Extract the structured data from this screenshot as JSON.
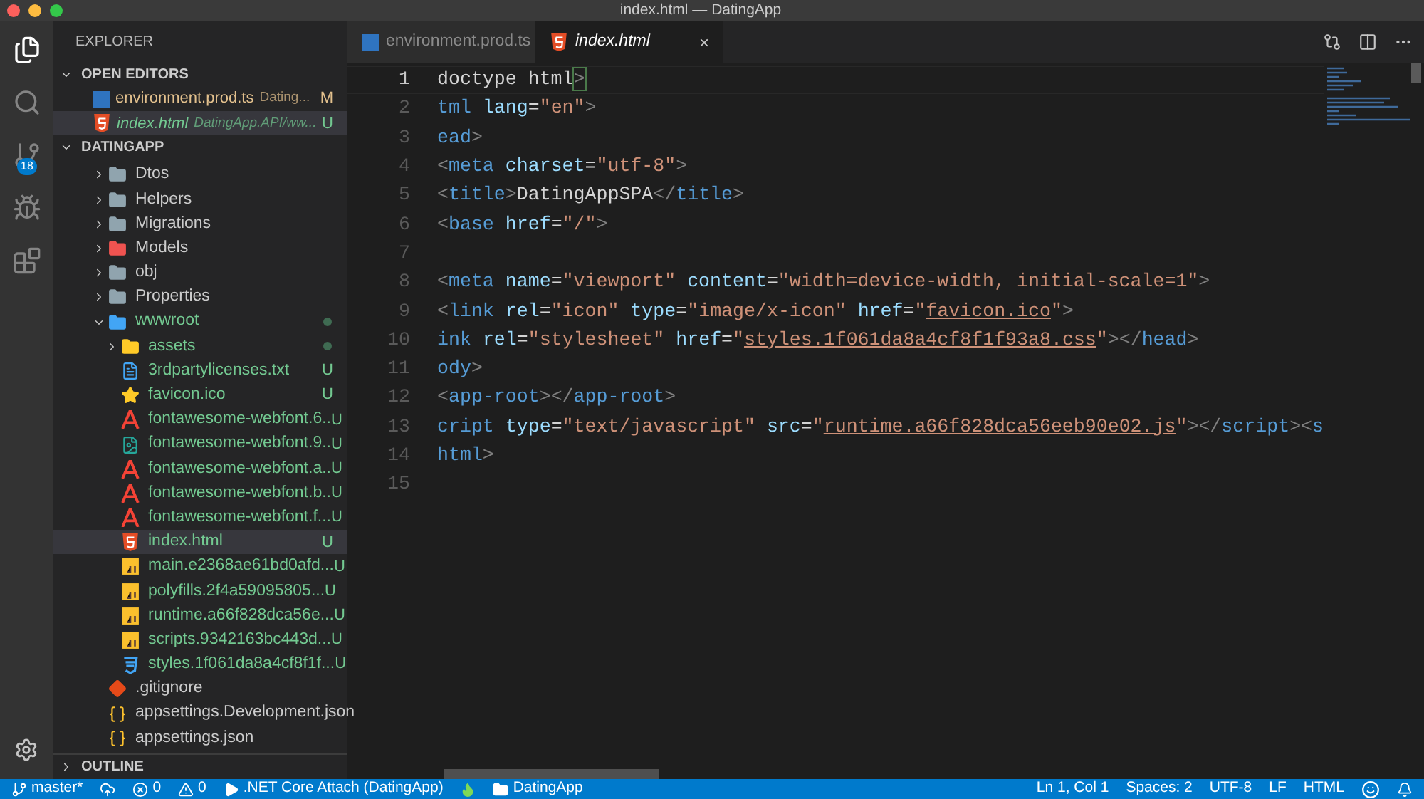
{
  "window": {
    "title": "index.html — DatingApp"
  },
  "activity_bar": {
    "items": [
      {
        "kind": "files",
        "selected": true
      },
      {
        "kind": "search",
        "selected": false
      },
      {
        "kind": "scm",
        "selected": false,
        "badge": "18"
      },
      {
        "kind": "debug",
        "selected": false
      },
      {
        "kind": "extensions",
        "selected": false
      }
    ]
  },
  "sidebar": {
    "title": "EXPLORER",
    "open_editors": {
      "label": "OPEN EDITORS",
      "expanded": true,
      "items": [
        {
          "name": "environment.prod.ts",
          "kind": "ts",
          "description": "Dating...",
          "badge": "M",
          "modified": true,
          "untracked": false,
          "italic": false,
          "selected": false
        },
        {
          "name": "index.html",
          "kind": "html",
          "description": "DatingApp.API/ww...",
          "badge": "U",
          "modified": false,
          "untracked": true,
          "italic": true,
          "selected": true
        }
      ]
    },
    "folder": {
      "label": "DATINGAPP",
      "expanded": true,
      "items": [
        {
          "name": "Dtos",
          "kind": "folder",
          "expanded": false,
          "untracked": false,
          "selected": false
        },
        {
          "name": "Helpers",
          "kind": "folder",
          "expanded": false,
          "untracked": false,
          "selected": false
        },
        {
          "name": "Migrations",
          "kind": "folder",
          "expanded": false,
          "untracked": false,
          "selected": false
        },
        {
          "name": "Models",
          "kind": "folder-red",
          "expanded": false,
          "untracked": false,
          "selected": false
        },
        {
          "name": "obj",
          "kind": "folder",
          "expanded": false,
          "untracked": false,
          "selected": false
        },
        {
          "name": "Properties",
          "kind": "folder",
          "expanded": false,
          "untracked": false,
          "selected": false
        },
        {
          "name": "wwwroot",
          "kind": "folder-blue",
          "expanded": true,
          "untracked": true,
          "dot": true,
          "selected": false,
          "children": [
            {
              "name": "assets",
              "kind": "folder-yellow",
              "expanded": false,
              "untracked": true,
              "dot": true,
              "selected": false
            },
            {
              "name": "3rdpartylicenses.txt",
              "kind": "txt",
              "badge": "U",
              "untracked": true,
              "selected": false
            },
            {
              "name": "favicon.ico",
              "kind": "star",
              "badge": "U",
              "untracked": true,
              "selected": false
            },
            {
              "name": "fontawesome-webfont.6..",
              "kind": "font",
              "badge": "U",
              "untracked": true,
              "selected": false
            },
            {
              "name": "fontawesome-webfont.9..",
              "kind": "image",
              "badge": "U",
              "untracked": true,
              "selected": false
            },
            {
              "name": "fontawesome-webfont.a..",
              "kind": "font",
              "badge": "U",
              "untracked": true,
              "selected": false
            },
            {
              "name": "fontawesome-webfont.b..",
              "kind": "font",
              "badge": "U",
              "untracked": true,
              "selected": false
            },
            {
              "name": "fontawesome-webfont.f...",
              "kind": "font",
              "badge": "U",
              "untracked": true,
              "selected": false
            },
            {
              "name": "index.html",
              "kind": "html",
              "badge": "U",
              "untracked": true,
              "selected": true
            },
            {
              "name": "main.e2368ae61bd0afd...",
              "kind": "js",
              "badge": "U",
              "untracked": true,
              "selected": false
            },
            {
              "name": "polyfills.2f4a59095805...",
              "kind": "js",
              "badge": "U",
              "untracked": true,
              "selected": false
            },
            {
              "name": "runtime.a66f828dca56e...",
              "kind": "js",
              "badge": "U",
              "untracked": true,
              "selected": false
            },
            {
              "name": "scripts.9342163bc443d...",
              "kind": "js",
              "badge": "U",
              "untracked": true,
              "selected": false
            },
            {
              "name": "styles.1f061da8a4cf8f1f...",
              "kind": "css",
              "badge": "U",
              "untracked": true,
              "selected": false
            }
          ]
        },
        {
          "name": ".gitignore",
          "kind": "git",
          "untracked": false,
          "selected": false
        },
        {
          "name": "appsettings.Development.json",
          "kind": "json",
          "untracked": false,
          "selected": false
        },
        {
          "name": "appsettings.json",
          "kind": "json",
          "untracked": false,
          "selected": false
        }
      ]
    },
    "outline": {
      "label": "OUTLINE",
      "expanded": false
    }
  },
  "tabs": [
    {
      "label": "environment.prod.ts",
      "kind": "ts",
      "selected": false,
      "italic": false
    },
    {
      "label": "index.html",
      "kind": "html",
      "selected": true,
      "italic": true,
      "close": "×"
    }
  ],
  "editor": {
    "lines": [
      {
        "number": "1",
        "current": true,
        "leading_tag": false,
        "bracket_match": true,
        "text": "doctype html>"
      },
      {
        "number": "2",
        "current": false,
        "leading_tag": true,
        "text": "tml lang=\"en\">"
      },
      {
        "number": "3",
        "current": false,
        "leading_tag": true,
        "text": "ead>"
      },
      {
        "number": "4",
        "current": false,
        "text": "<meta charset=\"utf-8\">"
      },
      {
        "number": "5",
        "current": false,
        "text": "<title>DatingAppSPA</title>"
      },
      {
        "number": "6",
        "current": false,
        "text": "<base href=\"/\">"
      },
      {
        "number": "7",
        "current": false
      },
      {
        "number": "8",
        "current": false,
        "text": "<meta name=\"viewport\" content=\"width=device-width, initial-scale=1\">"
      },
      {
        "number": "9",
        "current": false,
        "text": "<link rel=\"icon\" type=\"image/x-icon\" href=\"favicon.ico\">"
      },
      {
        "number": "10",
        "current": false,
        "leading_tag": true,
        "text": "ink rel=\"stylesheet\" href=\"styles.1f061da8a4cf8f1f93a8.css\"></head>"
      },
      {
        "number": "11",
        "current": false,
        "leading_tag": true,
        "text": "ody>"
      },
      {
        "number": "12",
        "current": false,
        "text": "<app-root></app-root>"
      },
      {
        "number": "13",
        "current": false,
        "leading_tag": true,
        "text": "cript type=\"text/javascript\" src=\"runtime.a66f828dca56eeb90e02.js\"></script><s"
      },
      {
        "number": "14",
        "current": false,
        "leading_tag": true,
        "text": "html>"
      },
      {
        "number": "15",
        "current": false
      }
    ]
  },
  "status_bar": {
    "left": [
      {
        "kind": "branch",
        "text": "master*"
      },
      {
        "kind": "sync"
      },
      {
        "kind": "errors",
        "text": "0"
      },
      {
        "kind": "warnings",
        "text": "0"
      },
      {
        "kind": "debug",
        "text": ".NET Core Attach (DatingApp)"
      },
      {
        "kind": "flame"
      },
      {
        "kind": "folder",
        "text": "DatingApp"
      }
    ],
    "right": [
      {
        "kind": "text",
        "text": "Ln 1, Col 1"
      },
      {
        "kind": "text",
        "text": "Spaces: 2"
      },
      {
        "kind": "text",
        "text": "UTF-8"
      },
      {
        "kind": "text",
        "text": "LF"
      },
      {
        "kind": "text",
        "text": "HTML"
      },
      {
        "kind": "feedback"
      },
      {
        "kind": "bell"
      }
    ]
  }
}
